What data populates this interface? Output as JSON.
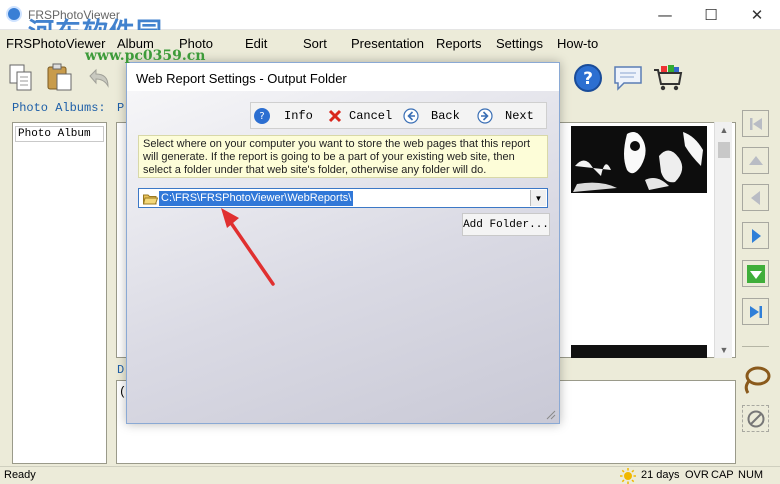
{
  "window": {
    "title": "FRSPhotoViewer",
    "watermark": "河东软件园",
    "watermark_url": "www.pc0359.cn",
    "controls": {
      "minimize": "—",
      "maximize": "☐",
      "close": "✕"
    }
  },
  "menu": [
    "FRSPhotoViewer",
    "Album",
    "Photo",
    "Edit",
    "Sort",
    "Presentation",
    "Reports",
    "Settings",
    "How-to"
  ],
  "left_panel": {
    "albums_label": "Photo Albums:",
    "photos_label_partial": "P",
    "albums": [
      "Photo Album"
    ]
  },
  "description": {
    "label_partial": "D",
    "text_partial": "("
  },
  "dialog": {
    "title": "Web Report Settings - Output Folder",
    "buttons": {
      "info": "Info",
      "cancel": "Cancel",
      "back": "Back",
      "next": "Next"
    },
    "instructions": "Select where on your computer you want to store the web pages that this report will generate. If the report is going to be a part of your existing web site, then select a folder under that web site's folder, otherwise any folder will do.",
    "path": "C:\\FRS\\FRSPhotoViewer\\WebReports\\",
    "add_folder": "Add Folder..."
  },
  "status": {
    "ready": "Ready",
    "days": "21 days",
    "ovr": "OVR",
    "cap": "CAP",
    "num": "NUM"
  },
  "colors": {
    "accent_blue": "#3178d8",
    "label_blue": "#1e5fa8",
    "background": "#ecebd9",
    "nav_green": "#3fae3a",
    "nav_blue": "#2f7fd8",
    "arrow_red": "#e03030"
  }
}
